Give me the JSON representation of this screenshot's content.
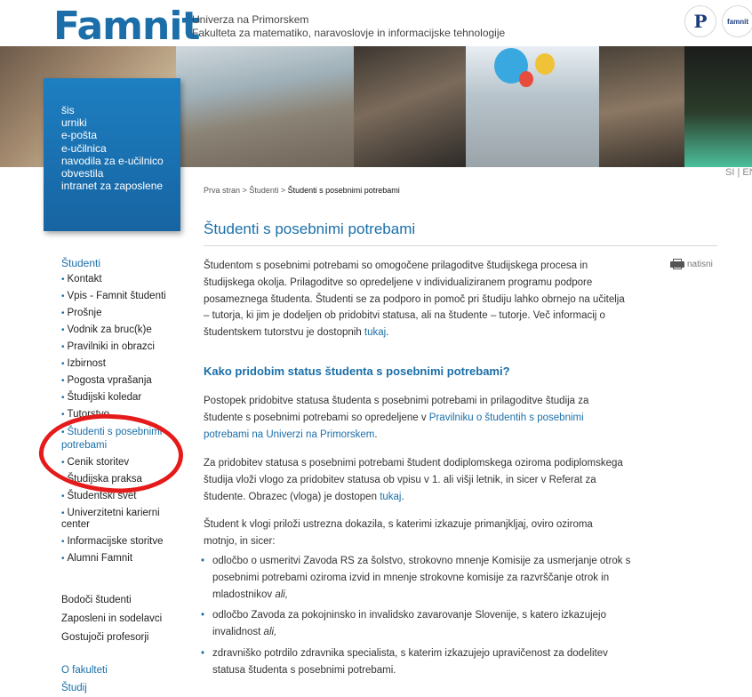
{
  "header": {
    "logo": "Famnit",
    "university": "Univerza na Primorskem",
    "faculty": "Fakulteta za matematiko, naravoslovje in informacijske tehnologije",
    "partner_logo_1": "P",
    "partner_logo_2": "famnit"
  },
  "quick_links": [
    "šis",
    "urniki",
    "e-pošta",
    "e-učilnica",
    "navodila za e-učilnico",
    "obvestila",
    "intranet za zaposlene"
  ],
  "language": "SI | EN",
  "breadcrumb": {
    "home": "Prva stran",
    "sep": ">",
    "level1": "Študenti",
    "current": "Študenti s posebnimi potrebami"
  },
  "nav": {
    "heading": "Študenti",
    "items": [
      "Kontakt",
      "Vpis - Famnit študenti",
      "Prošnje",
      "Vodnik za bruc(k)e",
      "Pravilniki in obrazci",
      "Izbirnost",
      "Pogosta vprašanja",
      "Študijski koledar",
      "Tutorstvo",
      "Študenti s posebnimi potrebami",
      "Cenik storitev",
      "Študijska praksa",
      "Študentski svet",
      "Univerzitetni karierni center",
      "Informacijske storitve",
      "Alumni Famnit"
    ],
    "sections": [
      "Bodoči študenti",
      "Zaposleni in sodelavci",
      "Gostujoči profesorji"
    ],
    "sections2": [
      "O fakulteti",
      "Študij"
    ]
  },
  "content": {
    "title": "Študenti s posebnimi potrebami",
    "print": "natisni",
    "p1_text": "Študentom s posebnimi potrebami so omogočene prilagoditve študijskega procesa in študijskega okolja. Prilagoditve so opredeljene v individualiziranem programu podpore posameznega študenta. Študenti se za podporo in pomoč pri študiju lahko obrnejo na učitelja – tutorja, ki jim je dodeljen ob pridobitvi statusa, ali na študente – tutorje. Več informacij o študentskem tutorstvu je dostopnih ",
    "p1_link": "tukaj",
    "p1_end": ".",
    "h2": "Kako pridobim status študenta s posebnimi potrebami?",
    "p2_text": "Postopek pridobitve statusa študenta s posebnimi potrebami in prilagoditve študija za študente s posebnimi potrebami so opredeljene v ",
    "p2_link": "Pravilniku o študentih s posebnimi potrebami na Univerzi na Primorskem",
    "p2_end": ".",
    "p3_text": "Za pridobitev statusa s posebnimi potrebami študent dodiplomskega oziroma podiplomskega študija vloži vlogo za pridobitev statusa ob vpisu v 1. ali višji letnik, in sicer v Referat za študente. Obrazec (vloga) je dostopen ",
    "p3_link": "tukaj",
    "p3_end": ".",
    "p4_text": "Študent k vlogi priloži ustrezna dokazila, s katerimi izkazuje primanjkljaj, oviro oziroma motnjo, in sicer:",
    "b1_text": "odločbo o usmeritvi Zavoda RS za šolstvo, strokovno mnenje Komisije za usmerjanje otrok s posebnimi potrebami oziroma izvid in mnenje strokovne komisije za razvrščanje otrok in mladostnikov ",
    "b1_em": "ali,",
    "b2_text": "odločbo Zavoda za pokojninsko in invalidsko zavarovanje Slovenije, s katero izkazujejo invalidnost ",
    "b2_em": "ali,",
    "b3_text": "zdravniško potrdilo zdravnika specialista, s katerim izkazujejo upravičenost za dodelitev statusa študenta s posebnimi potrebami."
  }
}
